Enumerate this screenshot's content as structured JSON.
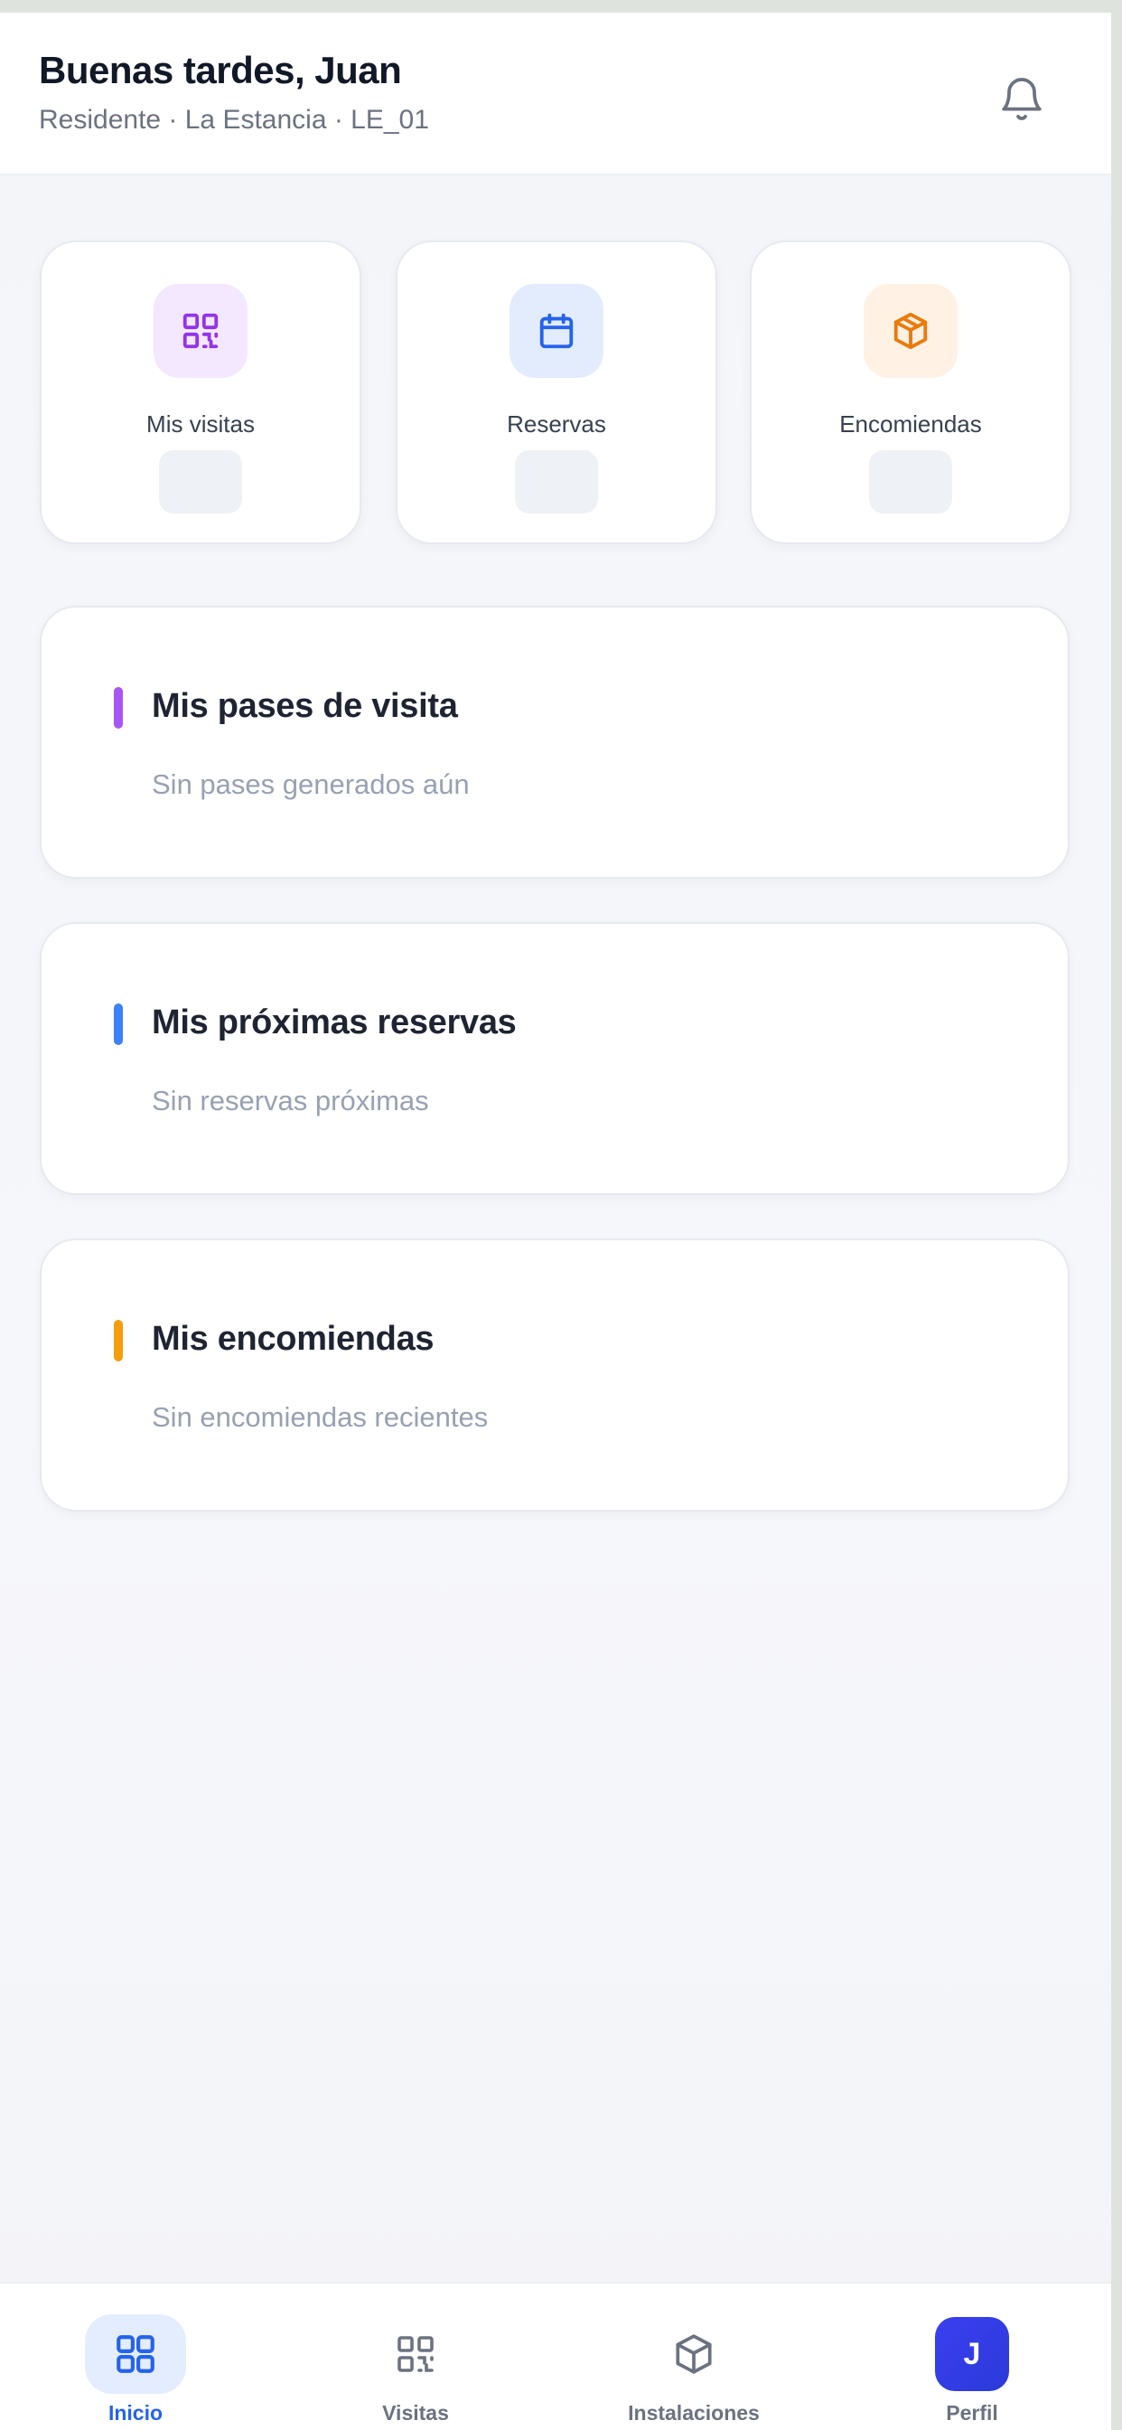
{
  "header": {
    "greeting": "Buenas tardes, Juan",
    "subtitle": "Residente · La Estancia · LE_01",
    "notification_icon": "bell-icon"
  },
  "quick_actions": [
    {
      "label": "Mis visitas",
      "icon": "qr-code-icon",
      "color": "#9333ea",
      "bg": "#f3e8ff"
    },
    {
      "label": "Reservas",
      "icon": "calendar-icon",
      "color": "#2563eb",
      "bg": "#e3ecfd"
    },
    {
      "label": "Encomiendas",
      "icon": "package-icon",
      "color": "#ea7a0c",
      "bg": "#fff1e4"
    }
  ],
  "sections": [
    {
      "title": "Mis pases de visita",
      "empty": "Sin pases generados aún",
      "accent": "#a855f7"
    },
    {
      "title": "Mis próximas reservas",
      "empty": "Sin reservas próximas",
      "accent": "#3b82f6"
    },
    {
      "title": "Mis encomiendas",
      "empty": "Sin encomiendas recientes",
      "accent": "#f59e0b"
    }
  ],
  "nav": [
    {
      "label": "Inicio",
      "icon": "dashboard-grid-icon",
      "active": true
    },
    {
      "label": "Visitas",
      "icon": "qr-code-icon",
      "active": false
    },
    {
      "label": "Instalaciones",
      "icon": "package-icon",
      "active": false
    },
    {
      "label": "Perfil",
      "avatar_initial": "J",
      "active": false
    }
  ],
  "colors": {
    "primary": "#2563eb",
    "avatar": "#3b3ff0"
  }
}
